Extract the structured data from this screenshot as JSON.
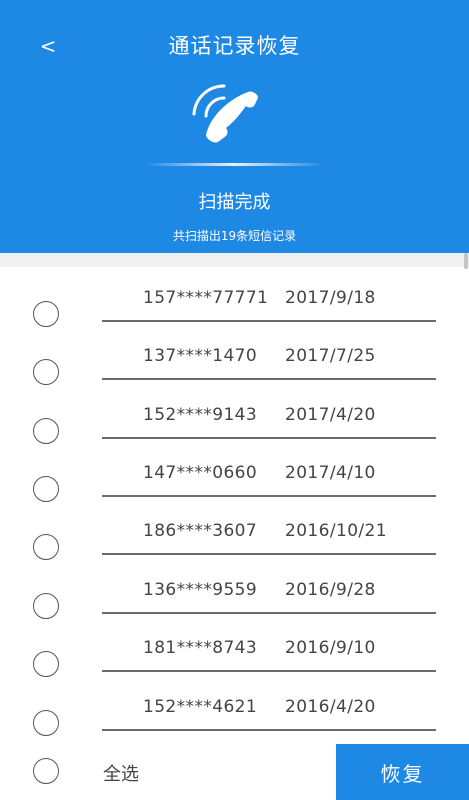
{
  "header": {
    "back_label": "<",
    "title": "通话记录恢复",
    "status": "扫描完成",
    "subtitle": "共扫描出19条短信记录",
    "color": "#1e88e5"
  },
  "records": [
    {
      "phone": "157****77771",
      "date": "2017/9/18"
    },
    {
      "phone": "137****1470",
      "date": "2017/7/25"
    },
    {
      "phone": "152****9143",
      "date": "2017/4/20"
    },
    {
      "phone": "147****0660",
      "date": "2017/4/10"
    },
    {
      "phone": "186****3607",
      "date": "2016/10/21"
    },
    {
      "phone": "136****9559",
      "date": "2016/9/28"
    },
    {
      "phone": "181****8743",
      "date": "2016/9/10"
    },
    {
      "phone": "152****4621",
      "date": "2016/4/20"
    }
  ],
  "footer": {
    "select_all_label": "全选",
    "restore_label": "恢复"
  }
}
